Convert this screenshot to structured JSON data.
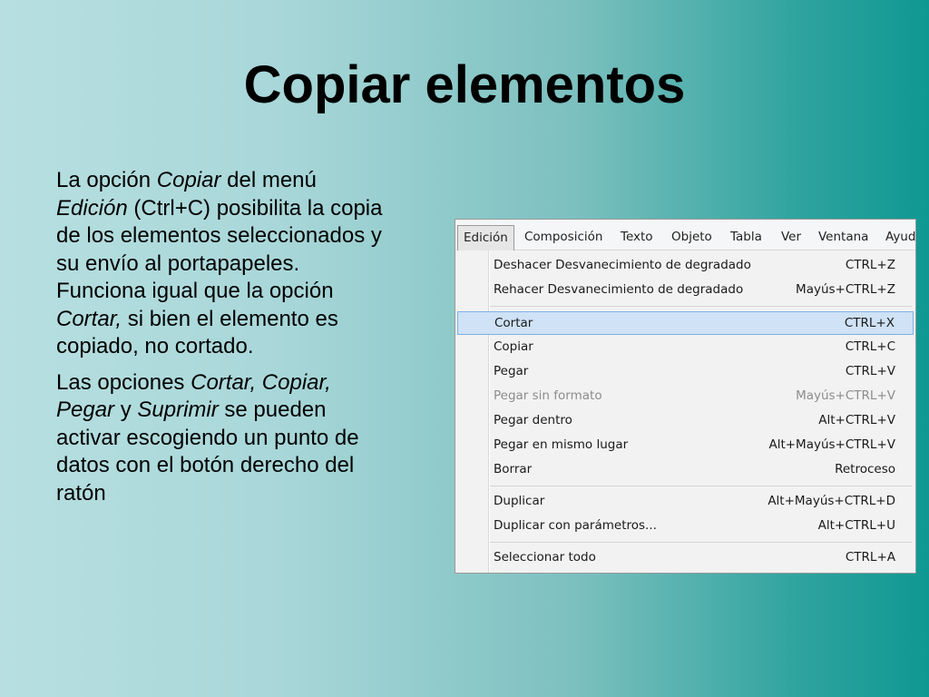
{
  "slide": {
    "title": "Copiar elementos",
    "paragraph1": {
      "t1": "La opción ",
      "i1": "Copiar",
      "t2": " del menú ",
      "i2": "Edición",
      "t3": " (Ctrl+C) posibilita la copia de los elementos seleccionados y su envío al portapapeles. Funciona igual que la opción ",
      "i3": "Cortar,",
      "t4": " si bien el elemento es copiado, no cortado."
    },
    "paragraph2": {
      "t1": "Las opciones ",
      "i1": "Cortar, Copiar, Pegar",
      "t2": " y ",
      "i2": "Suprimir",
      "t3": " se pueden activar escogiendo un punto de datos con el botón derecho del ratón"
    }
  },
  "menubar": {
    "items": [
      "Edición",
      "Composición",
      "Texto",
      "Objeto",
      "Tabla",
      "Ver",
      "Ventana",
      "Ayud"
    ]
  },
  "menu": {
    "items": [
      {
        "label": "Deshacer Desvanecimiento de degradado",
        "shortcut": "CTRL+Z"
      },
      {
        "label": "Rehacer Desvanecimiento de degradado",
        "shortcut": "Mayús+CTRL+Z"
      },
      {
        "label": "Cortar",
        "shortcut": "CTRL+X"
      },
      {
        "label": "Copiar",
        "shortcut": "CTRL+C"
      },
      {
        "label": "Pegar",
        "shortcut": "CTRL+V"
      },
      {
        "label": "Pegar sin formato",
        "shortcut": "Mayús+CTRL+V"
      },
      {
        "label": "Pegar dentro",
        "shortcut": "Alt+CTRL+V"
      },
      {
        "label": "Pegar en mismo lugar",
        "shortcut": "Alt+Mayús+CTRL+V"
      },
      {
        "label": "Borrar",
        "shortcut": "Retroceso"
      },
      {
        "label": "Duplicar",
        "shortcut": "Alt+Mayús+CTRL+D"
      },
      {
        "label": "Duplicar con parámetros...",
        "shortcut": "Alt+CTRL+U"
      },
      {
        "label": "Seleccionar todo",
        "shortcut": "CTRL+A"
      }
    ]
  }
}
